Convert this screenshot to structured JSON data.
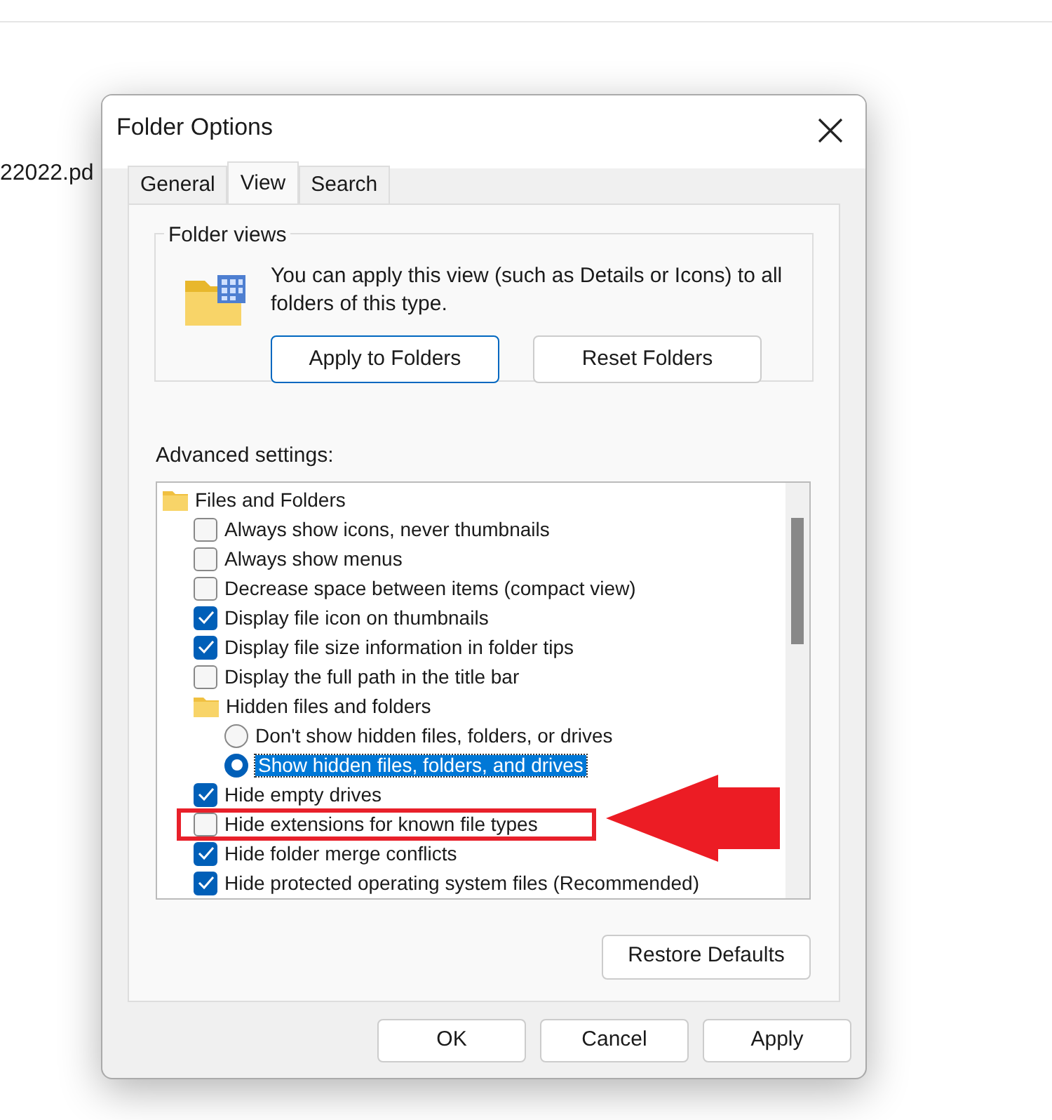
{
  "background": {
    "file_name": "22022.pd"
  },
  "dialog": {
    "title": "Folder Options",
    "tabs": [
      {
        "label": "General",
        "selected": false
      },
      {
        "label": "View",
        "selected": true
      },
      {
        "label": "Search",
        "selected": false
      }
    ],
    "folder_views": {
      "legend": "Folder views",
      "description": "You can apply this view (such as Details or Icons) to all folders of this type.",
      "buttons": [
        {
          "label": "Apply to Folders",
          "default": true
        },
        {
          "label": "Reset Folders",
          "default": false
        }
      ]
    },
    "advanced_settings": {
      "label": "Advanced settings:",
      "items": [
        {
          "kind": "group",
          "label": "Files and Folders",
          "children": [
            {
              "kind": "checkbox",
              "label": "Always show icons, never thumbnails",
              "checked": false
            },
            {
              "kind": "checkbox",
              "label": "Always show menus",
              "checked": false
            },
            {
              "kind": "checkbox",
              "label": "Decrease space between items (compact view)",
              "checked": false
            },
            {
              "kind": "checkbox",
              "label": "Display file icon on thumbnails",
              "checked": true
            },
            {
              "kind": "checkbox",
              "label": "Display file size information in folder tips",
              "checked": true
            },
            {
              "kind": "checkbox",
              "label": "Display the full path in the title bar",
              "checked": false
            },
            {
              "kind": "group",
              "label": "Hidden files and folders",
              "children": [
                {
                  "kind": "radio",
                  "label": "Don't show hidden files, folders, or drives",
                  "selected": false
                },
                {
                  "kind": "radio",
                  "label": "Show hidden files, folders, and drives",
                  "selected": true
                }
              ]
            },
            {
              "kind": "checkbox",
              "label": "Hide empty drives",
              "checked": true
            },
            {
              "kind": "checkbox",
              "label": "Hide extensions for known file types",
              "checked": false,
              "highlighted": true
            },
            {
              "kind": "checkbox",
              "label": "Hide folder merge conflicts",
              "checked": true
            },
            {
              "kind": "checkbox",
              "label": "Hide protected operating system files (Recommended)",
              "checked": true
            }
          ]
        }
      ]
    },
    "restore_button": "Restore Defaults",
    "buttons": [
      "OK",
      "Cancel",
      "Apply"
    ]
  }
}
